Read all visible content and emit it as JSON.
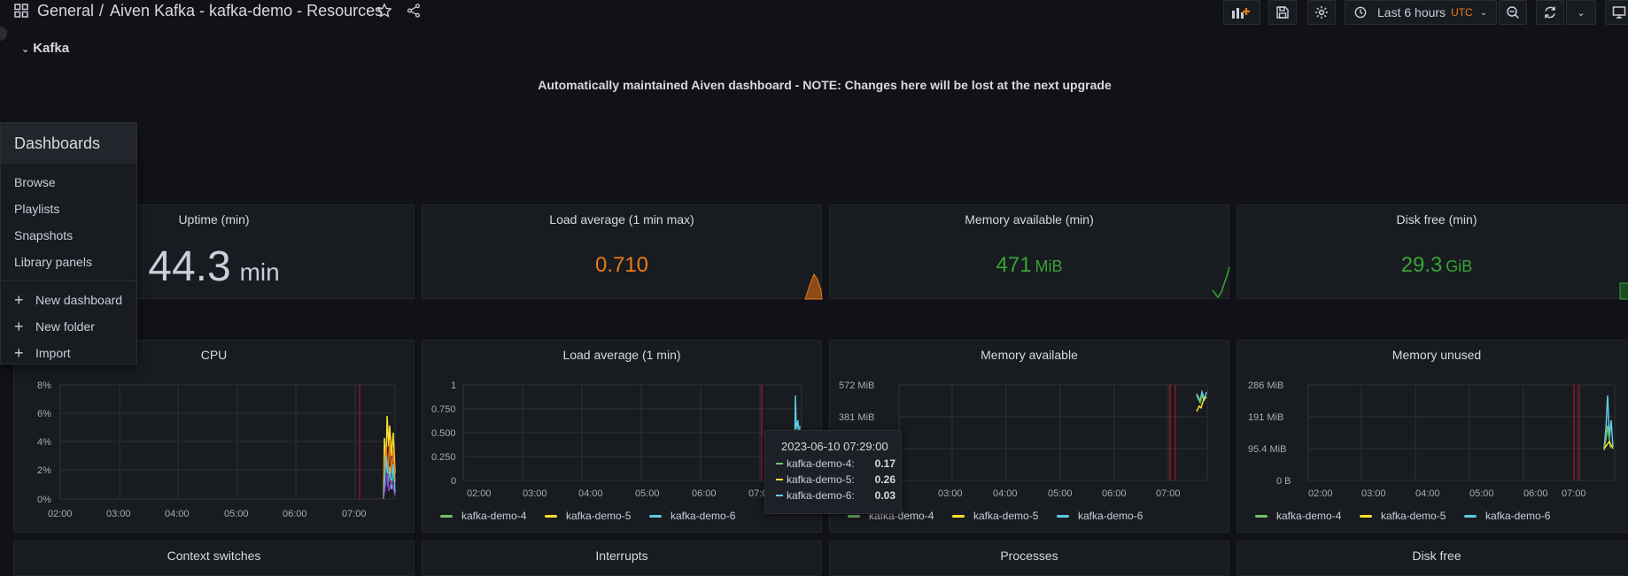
{
  "topbar": {
    "breadcrumb_root": "General",
    "breadcrumb_sep": "/",
    "dashboard_title": "Aiven Kafka - kafka-demo - Resources",
    "time_range": "Last 6 hours",
    "timezone": "UTC"
  },
  "row": {
    "title": "Kafka"
  },
  "notice": "Automatically maintained Aiven dashboard - NOTE: Changes here will be lost at the next upgrade",
  "menu": {
    "heading": "Dashboards",
    "items": [
      "Browse",
      "Playlists",
      "Snapshots",
      "Library panels"
    ],
    "actions": [
      "New dashboard",
      "New folder",
      "Import"
    ]
  },
  "stats": [
    {
      "title": "Uptime (min)",
      "value": "44.3",
      "unit": "min",
      "color": "#ccccdc"
    },
    {
      "title": "Load average (1 min max)",
      "value": "0.710",
      "unit": "",
      "color": "#eb7b18"
    },
    {
      "title": "Memory available (min)",
      "value": "471",
      "unit": "MiB",
      "color": "#37a536"
    },
    {
      "title": "Disk free (min)",
      "value": "29.3",
      "unit": "GiB",
      "color": "#37a536"
    }
  ],
  "graphs": {
    "cpu": {
      "title": "CPU",
      "yticks": [
        "8%",
        "6%",
        "4%",
        "2%",
        "0%"
      ]
    },
    "load": {
      "title": "Load average (1 min)",
      "yticks": [
        "1",
        "0.750",
        "0.500",
        "0.250",
        "0"
      ]
    },
    "memavail": {
      "title": "Memory available",
      "yticks": [
        "572 MiB",
        "381 MiB"
      ]
    },
    "memunused": {
      "title": "Memory unused",
      "yticks": [
        "286 MiB",
        "191 MiB",
        "95.4 MiB",
        "0 B"
      ]
    },
    "xticks": [
      "02:00",
      "03:00",
      "04:00",
      "05:00",
      "06:00",
      "07:00"
    ]
  },
  "legend": [
    {
      "name": "kafka-demo-4",
      "color": "#73bf69"
    },
    {
      "name": "kafka-demo-5",
      "color": "#fade2a"
    },
    {
      "name": "kafka-demo-6",
      "color": "#5dcbe4"
    }
  ],
  "tooltip": {
    "time": "2023-06-10 07:29:00",
    "rows": [
      {
        "name": "kafka-demo-4:",
        "value": "0.17",
        "color": "#73bf69"
      },
      {
        "name": "kafka-demo-5:",
        "value": "0.26",
        "color": "#fade2a"
      },
      {
        "name": "kafka-demo-6:",
        "value": "0.03",
        "color": "#5dcbe4"
      }
    ]
  },
  "bottom_panels": [
    "Context switches",
    "Interrupts",
    "Processes",
    "Disk free"
  ]
}
